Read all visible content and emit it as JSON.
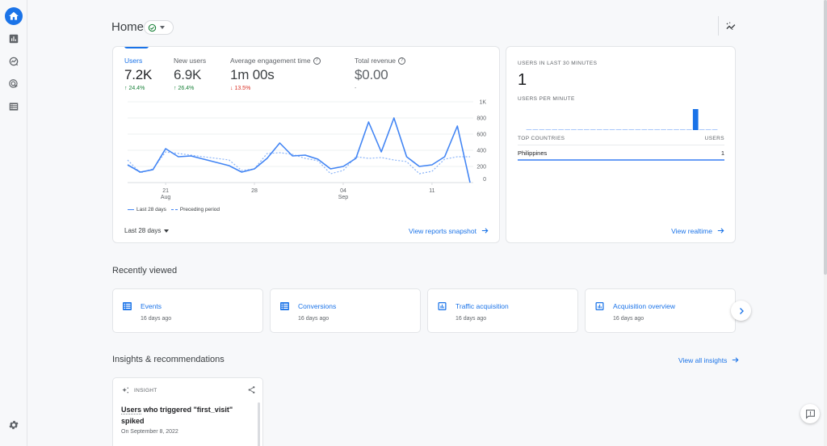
{
  "nav": {
    "items": [
      {
        "name": "home",
        "label": "Home",
        "active": true
      },
      {
        "name": "reports",
        "label": "Reports"
      },
      {
        "name": "explore",
        "label": "Explore"
      },
      {
        "name": "advertising",
        "label": "Advertising"
      },
      {
        "name": "configure",
        "label": "Configure"
      }
    ],
    "settings_label": "Admin"
  },
  "header": {
    "title": "Home",
    "status_icon": "check-circle-icon"
  },
  "metrics": [
    {
      "label": "Users",
      "value": "7.2K",
      "delta": "24.4%",
      "direction": "up",
      "active": true
    },
    {
      "label": "New users",
      "value": "6.9K",
      "delta": "26.4%",
      "direction": "up"
    },
    {
      "label": "Average engagement time",
      "value": "1m 00s",
      "delta": "13.5%",
      "direction": "down",
      "help": "?"
    },
    {
      "label": "Total revenue",
      "value": "$0.00",
      "delta": "-",
      "direction": "neutral",
      "help": "?"
    }
  ],
  "overview": {
    "range_label": "Last 28 days",
    "snapshot_link": "View reports snapshot",
    "legend": [
      "Last 28 days",
      "Preceding period"
    ]
  },
  "chart_data": {
    "type": "line",
    "title": "Users",
    "x": [
      "Aug 18",
      "Aug 19",
      "Aug 20",
      "Aug 21",
      "Aug 22",
      "Aug 23",
      "Aug 24",
      "Aug 25",
      "Aug 26",
      "Aug 27",
      "Aug 28",
      "Aug 29",
      "Aug 30",
      "Aug 31",
      "Sep 1",
      "Sep 2",
      "Sep 3",
      "Sep 4",
      "Sep 5",
      "Sep 6",
      "Sep 7",
      "Sep 8",
      "Sep 9",
      "Sep 10",
      "Sep 11",
      "Sep 12",
      "Sep 13",
      "Sep 14"
    ],
    "x_ticks": [
      {
        "index": 3,
        "day": "21",
        "month": "Aug"
      },
      {
        "index": 10,
        "day": "28",
        "month": ""
      },
      {
        "index": 17,
        "day": "04",
        "month": "Sep"
      },
      {
        "index": 24,
        "day": "11",
        "month": ""
      }
    ],
    "y_ticks": [
      "0",
      "200",
      "400",
      "600",
      "800",
      "1K"
    ],
    "ylim": [
      0,
      1000
    ],
    "grid": true,
    "legend_position": "bottom-left",
    "series": [
      {
        "name": "Last 28 days",
        "style": "solid",
        "color": "#4285f4",
        "values": [
          220,
          130,
          160,
          420,
          320,
          330,
          290,
          250,
          210,
          130,
          170,
          300,
          490,
          330,
          340,
          290,
          170,
          200,
          300,
          750,
          380,
          800,
          320,
          200,
          220,
          320,
          700,
          0
        ]
      },
      {
        "name": "Preceding period",
        "style": "dashed",
        "color": "#8ab4f8",
        "values": [
          280,
          120,
          170,
          380,
          360,
          340,
          320,
          300,
          280,
          150,
          170,
          360,
          370,
          350,
          300,
          270,
          110,
          150,
          320,
          300,
          310,
          280,
          260,
          110,
          140,
          290,
          320,
          320
        ]
      }
    ]
  },
  "realtime": {
    "users_label": "USERS IN LAST 30 MINUTES",
    "users_value": "1",
    "per_minute_label": "USERS PER MINUTE",
    "per_minute": [
      0,
      0,
      0,
      0,
      0,
      0,
      0,
      0,
      0,
      0,
      0,
      0,
      0,
      0,
      0,
      0,
      0,
      0,
      0,
      0,
      0,
      0,
      0,
      0,
      0,
      0,
      1,
      0,
      0,
      0
    ],
    "countries_header": "TOP COUNTRIES",
    "users_header": "USERS",
    "countries": [
      {
        "name": "Philippines",
        "users": "1"
      }
    ],
    "link": "View realtime",
    "accent": "#1a73e8"
  },
  "recently_viewed": {
    "title": "Recently viewed",
    "items": [
      {
        "title": "Events",
        "time": "16 days ago",
        "icon": "table-icon"
      },
      {
        "title": "Conversions",
        "time": "16 days ago",
        "icon": "table-icon"
      },
      {
        "title": "Traffic acquisition",
        "time": "16 days ago",
        "icon": "bar-chart-icon"
      },
      {
        "title": "Acquisition overview",
        "time": "16 days ago",
        "icon": "bar-chart-icon"
      }
    ]
  },
  "insights": {
    "title": "Insights & recommendations",
    "view_all": "View all insights",
    "card": {
      "tag": "INSIGHT",
      "title_underlined": "Users",
      "title_rest": " who triggered \"first_visit\" spiked",
      "date": "On September 8, 2022"
    }
  }
}
